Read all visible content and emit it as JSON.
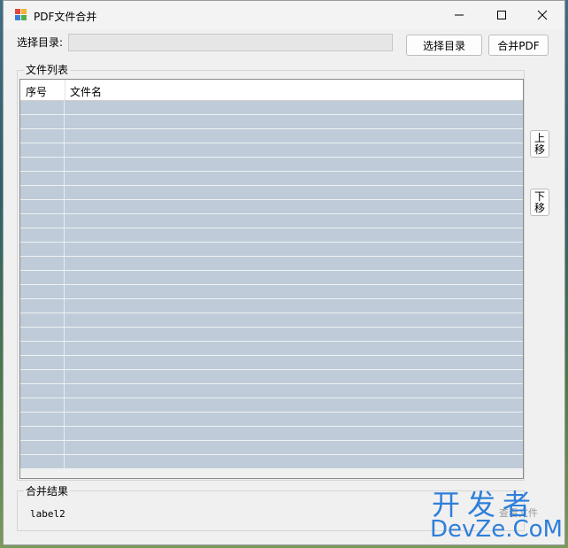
{
  "window": {
    "title": "PDF文件合并"
  },
  "toolbar": {
    "dir_label": "选择目录:",
    "dir_value": "",
    "select_dir_label": "选择目录",
    "merge_label": "合并PDF"
  },
  "file_list": {
    "group_title": "文件列表",
    "columns": [
      "序号",
      "文件名"
    ],
    "row_count": 26
  },
  "side_buttons": {
    "up_label": "上移",
    "down_label": "下移"
  },
  "result": {
    "group_title": "合并结果",
    "label": "label2"
  },
  "watermark": {
    "line1": "开发者",
    "line2": "DevZe.CoM",
    "ghost": "查看文件"
  },
  "colors": {
    "row_fill": "#bfcbd8",
    "watermark": "#2f7fd9"
  }
}
